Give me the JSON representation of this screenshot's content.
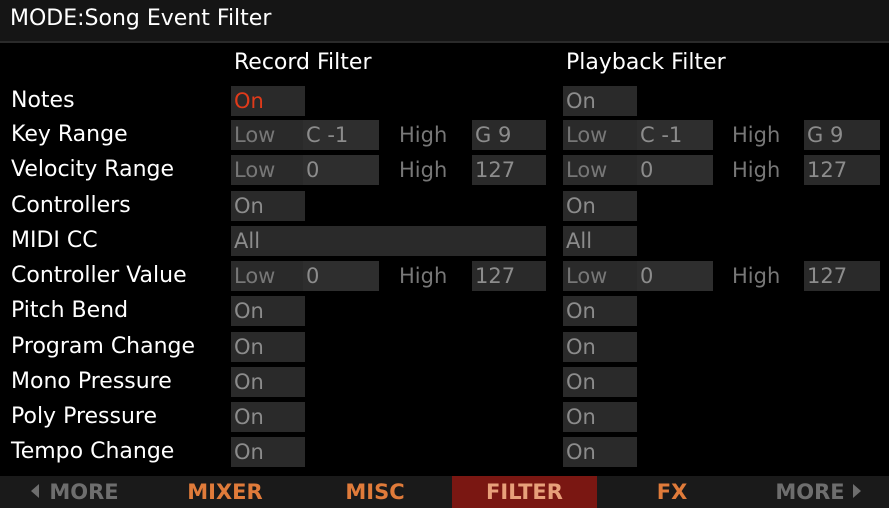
{
  "title": "MODE:Song Event Filter",
  "headers": {
    "record": "Record Filter",
    "playback": "Playback Filter"
  },
  "words": {
    "low": "Low",
    "high": "High"
  },
  "rows": {
    "notes": {
      "label": "Notes",
      "record": "On",
      "playback": "On"
    },
    "key_range": {
      "label": "Key Range",
      "rec_low": "C -1",
      "rec_high": "G 9",
      "pb_low": "C -1",
      "pb_high": "G 9"
    },
    "velocity": {
      "label": "Velocity Range",
      "rec_low": "0",
      "rec_high": "127",
      "pb_low": "0",
      "pb_high": "127"
    },
    "controllers": {
      "label": "Controllers",
      "record": "On",
      "playback": "On"
    },
    "midi_cc": {
      "label": "MIDI CC",
      "record": "All",
      "playback": "All"
    },
    "ctrl_value": {
      "label": "Controller Value",
      "rec_low": "0",
      "rec_high": "127",
      "pb_low": "0",
      "pb_high": "127"
    },
    "pitch_bend": {
      "label": "Pitch Bend",
      "record": "On",
      "playback": "On"
    },
    "program": {
      "label": "Program Change",
      "record": "On",
      "playback": "On"
    },
    "mono": {
      "label": "Mono Pressure",
      "record": "On",
      "playback": "On"
    },
    "poly": {
      "label": "Poly Pressure",
      "record": "On",
      "playback": "On"
    },
    "tempo": {
      "label": "Tempo Change",
      "record": "On",
      "playback": "On"
    }
  },
  "softbar": {
    "more_left": "MORE",
    "mixer": "MIXER",
    "misc": "MISC",
    "filter": "FILTER",
    "fx": "FX",
    "more_right": "MORE"
  },
  "colors": {
    "accent_red": "#e03a1a",
    "tab_highlight": "#7a1712",
    "tab_text": "#e07b3a",
    "field_bg": "#2a2a2a",
    "dim_text": "#777777"
  }
}
